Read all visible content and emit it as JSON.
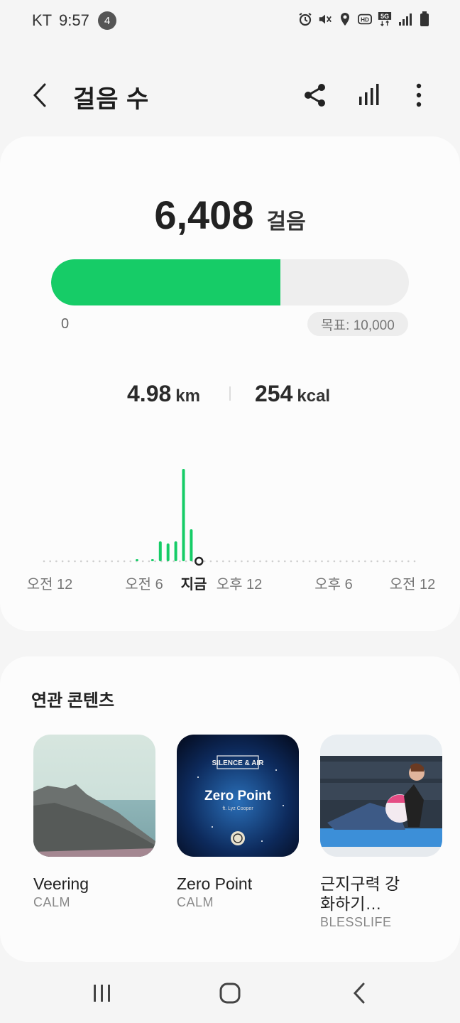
{
  "status_bar": {
    "carrier": "KT",
    "time": "9:57",
    "notification_count": "4",
    "icons": [
      "alarm-icon",
      "mute-icon",
      "location-icon",
      "hd-icon",
      "5g-icon",
      "signal-icon",
      "battery-icon"
    ]
  },
  "app_bar": {
    "title": "걸음 수",
    "icons": [
      "back-icon",
      "share-icon",
      "bar-chart-icon",
      "more-icon"
    ]
  },
  "summary": {
    "steps": "6,408",
    "steps_unit": "걸음",
    "progress_fraction": 0.6408,
    "progress_min": "0",
    "goal_label": "목표: 10,000",
    "distance_value": "4.98",
    "distance_unit": "km",
    "calories_value": "254",
    "calories_unit": "kcal"
  },
  "colors": {
    "accent": "#16cc67",
    "background": "#f5f5f5",
    "card": "#fcfcfc"
  },
  "chart_data": {
    "type": "bar",
    "x_unit": "hour of day",
    "x": [
      6,
      7,
      7.5,
      8,
      8.5,
      9,
      9.5
    ],
    "values": [
      3,
      3,
      28,
      25,
      28,
      130,
      45
    ],
    "tick_labels": [
      "오전 12",
      "오전 6",
      "지금",
      "오후 12",
      "오후 6",
      "오전 12"
    ],
    "now_label": "지금",
    "color": "#16cc67"
  },
  "related": {
    "title": "연관 콘텐츠",
    "items": [
      {
        "title": "Veering",
        "source": "CALM"
      },
      {
        "title": "Zero Point",
        "source": "CALM",
        "art_band": "SILENCE & AIR",
        "art_title": "Zero Point",
        "art_sub": "ft. Lyz Cooper"
      },
      {
        "title": "근지구력 강화하기…",
        "source": "BLESSLIFE"
      }
    ]
  },
  "nav_bar": {
    "icons": [
      "recents-icon",
      "home-icon",
      "back-nav-icon"
    ]
  }
}
